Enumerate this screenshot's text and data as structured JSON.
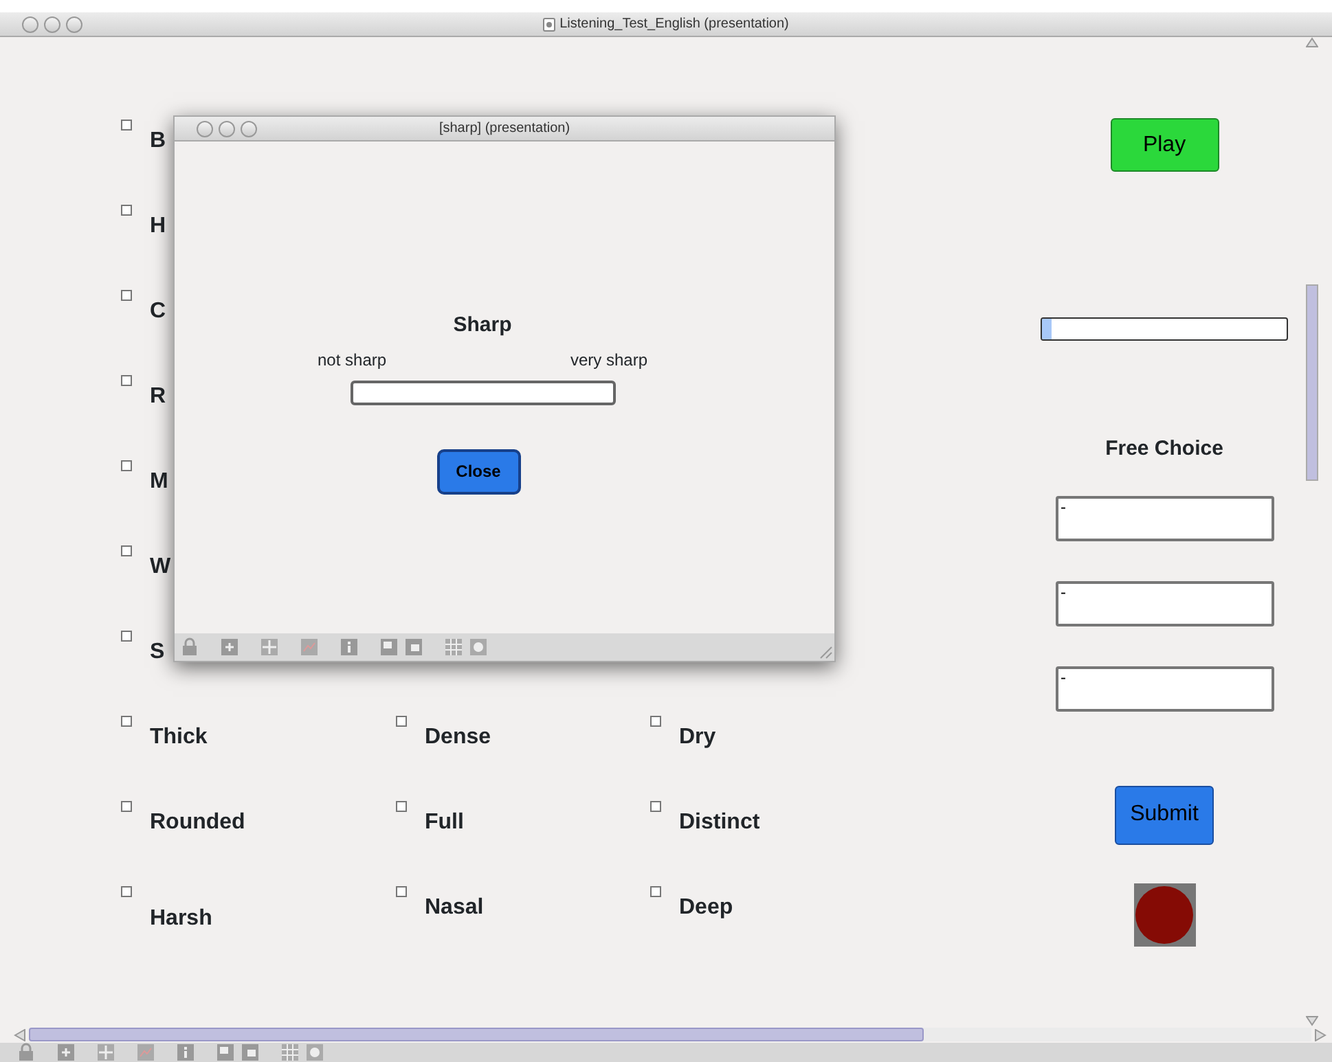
{
  "window": {
    "title": "Listening_Test_English (presentation)"
  },
  "grid": {
    "rows": [
      {
        "cells": [
          {
            "label": "B",
            "checked": false
          }
        ]
      },
      {
        "cells": [
          {
            "label": "H",
            "checked": false
          }
        ]
      },
      {
        "cells": [
          {
            "label": "C",
            "checked": false
          }
        ]
      },
      {
        "cells": [
          {
            "label": "R",
            "checked": false
          }
        ]
      },
      {
        "cells": [
          {
            "label": "M",
            "checked": false
          }
        ]
      },
      {
        "cells": [
          {
            "label": "W",
            "checked": false
          }
        ]
      },
      {
        "cells": [
          {
            "label": "S",
            "checked": false
          }
        ]
      },
      {
        "cells": [
          {
            "label": "Thick",
            "checked": false
          },
          {
            "label": "Dense",
            "checked": false
          },
          {
            "label": "Dry",
            "checked": false
          }
        ]
      },
      {
        "cells": [
          {
            "label": "Rounded",
            "checked": false
          },
          {
            "label": "Full",
            "checked": false
          },
          {
            "label": "Distinct",
            "checked": false
          }
        ]
      },
      {
        "cells": [
          {
            "label": "Harsh",
            "checked": false
          },
          {
            "label": "Nasal",
            "checked": false
          },
          {
            "label": "Deep",
            "checked": false
          }
        ]
      }
    ]
  },
  "side": {
    "play": "Play",
    "progress": {
      "level": 0.04
    },
    "free_choice_title": "Free Choice",
    "fields": [
      {
        "value": "-"
      },
      {
        "value": "-"
      },
      {
        "value": "-"
      }
    ],
    "submit": "Submit",
    "indicator": {
      "color": "#850b05"
    }
  },
  "dialog": {
    "title": "[sharp] (presentation)",
    "heading": "Sharp",
    "low_label": "not sharp",
    "high_label": "very sharp",
    "close": "Close"
  }
}
